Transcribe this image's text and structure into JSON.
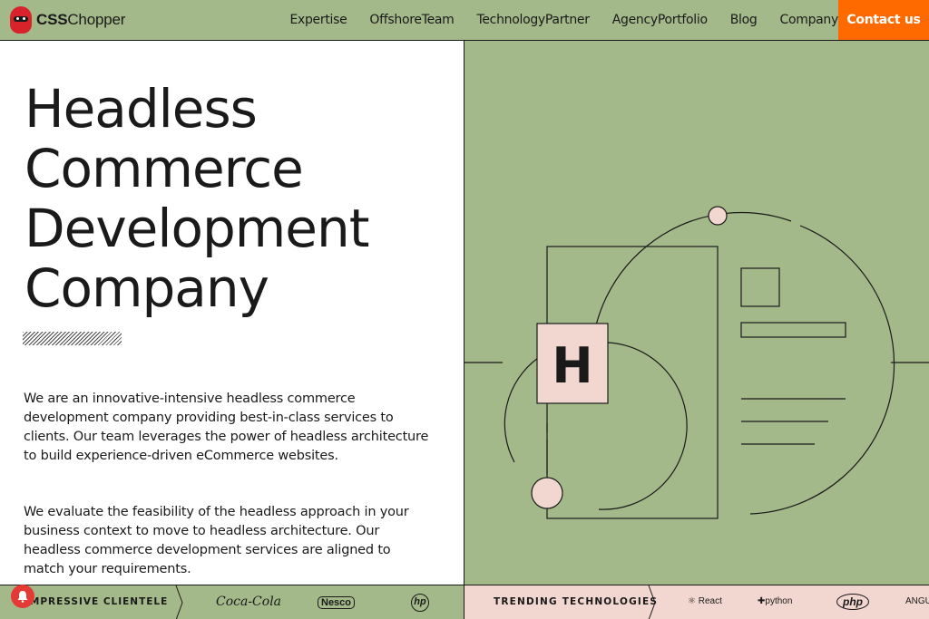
{
  "header": {
    "logo": {
      "bold": "CSS",
      "rest": "Chopper"
    },
    "nav": [
      "Expertise",
      "OffshoreTeam",
      "TechnologyPartner",
      "AgencyPortfolio",
      "Blog",
      "Company"
    ],
    "cta": "Contact us"
  },
  "hero": {
    "title_lines": [
      "Headless",
      "Commerce",
      "Development",
      "Company"
    ],
    "paragraph1": "We are an innovative-intensive headless commerce development company providing best-in-class services to clients. Our team leverages the power of headless architecture to build experience-driven eCommerce websites.",
    "paragraph2": "We evaluate the feasibility of the headless approach in your business context to move to headless architecture. Our headless commerce development services are aligned to match your requirements.",
    "illustration_letter": "H"
  },
  "strip": {
    "clientele_label": "IMPRESSIVE CLIENTELE",
    "clients": [
      "Coca-Cola",
      "Nesco",
      "hp"
    ],
    "tech_label": "TRENDING TECHNOLOGIES",
    "technologies": [
      "React",
      "python",
      "php",
      "ANGU"
    ]
  },
  "colors": {
    "green": "#a4b98a",
    "orange": "#ff6a00",
    "pink": "#f2d7d0",
    "ink": "#1a1a1a"
  }
}
